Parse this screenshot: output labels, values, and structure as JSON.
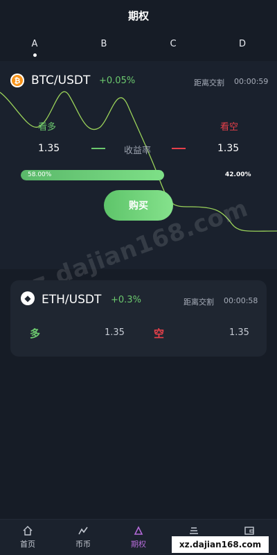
{
  "header": {
    "title": "期权"
  },
  "period_tabs": [
    {
      "label": "A",
      "active": true
    },
    {
      "label": "B",
      "active": false
    },
    {
      "label": "C",
      "active": false
    },
    {
      "label": "D",
      "active": false
    }
  ],
  "main": {
    "icon": "bitcoin-icon",
    "pair": "BTC/USDT",
    "change": "+0.05%",
    "countdown_label": "距离交割",
    "countdown": "00:00:59",
    "long_label": "看多",
    "short_label": "看空",
    "long_value": "1.35",
    "short_value": "1.35",
    "rate_label": "收益率",
    "long_pct": "58.00%",
    "short_pct": "42.00%",
    "long_fraction": 0.58,
    "buy_label": "购买",
    "colors": {
      "up": "#6cc96e",
      "down": "#e8404a"
    }
  },
  "card": {
    "icon": "ethereum-icon",
    "pair": "ETH/USDT",
    "change": "+0.3%",
    "countdown_label": "距离交割",
    "countdown": "00:00:58",
    "long_label": "多",
    "long_value": "1.35",
    "short_label": "空",
    "short_value": "1.35"
  },
  "watermark": "xz.dajian168.com",
  "bottom_nav": [
    {
      "label": "首页",
      "icon": "home-icon",
      "active": false
    },
    {
      "label": "币币",
      "icon": "chart-icon",
      "active": false
    },
    {
      "label": "期权",
      "icon": "options-icon",
      "active": true
    },
    {
      "label": "",
      "icon": "list-icon",
      "active": false
    },
    {
      "label": "",
      "icon": "wallet-icon",
      "active": false
    }
  ],
  "brand_watermark": "xz.dajian168.com"
}
